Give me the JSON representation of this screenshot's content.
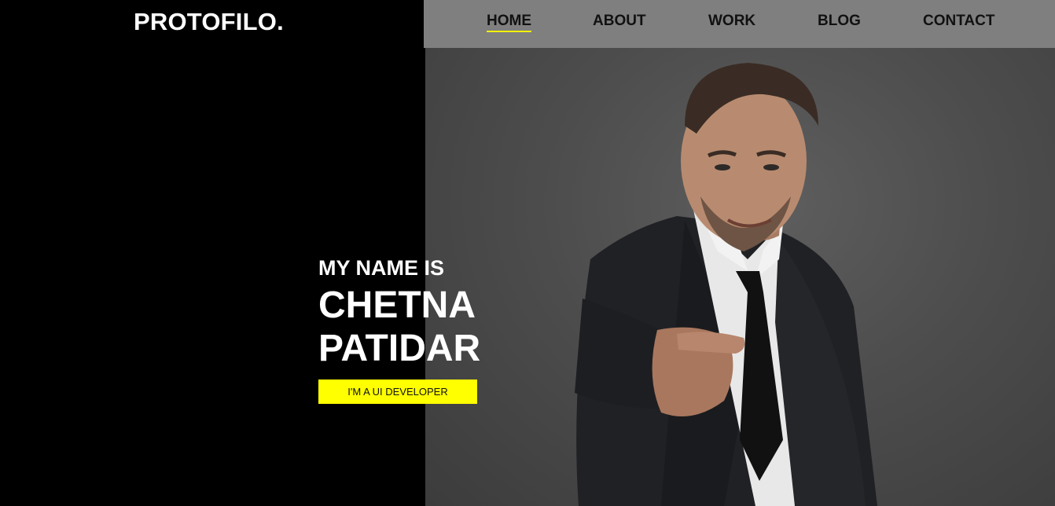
{
  "brand": {
    "logo": "PROTOFILO."
  },
  "nav": {
    "items": [
      {
        "label": "HOME",
        "active": true
      },
      {
        "label": "ABOUT",
        "active": false
      },
      {
        "label": "WORK",
        "active": false
      },
      {
        "label": "BLOG",
        "active": false
      },
      {
        "label": "CONTACT",
        "active": false
      }
    ]
  },
  "hero": {
    "intro": "MY NAME IS",
    "name_line1": "CHETNA",
    "name_line2": "PATIDAR",
    "role_badge": "I'M A UI DEVELOPER"
  },
  "colors": {
    "accent": "#ffff00",
    "nav_background": "#7f7f7f",
    "left_background": "#000000",
    "photo_background": "#4d4d4d"
  }
}
